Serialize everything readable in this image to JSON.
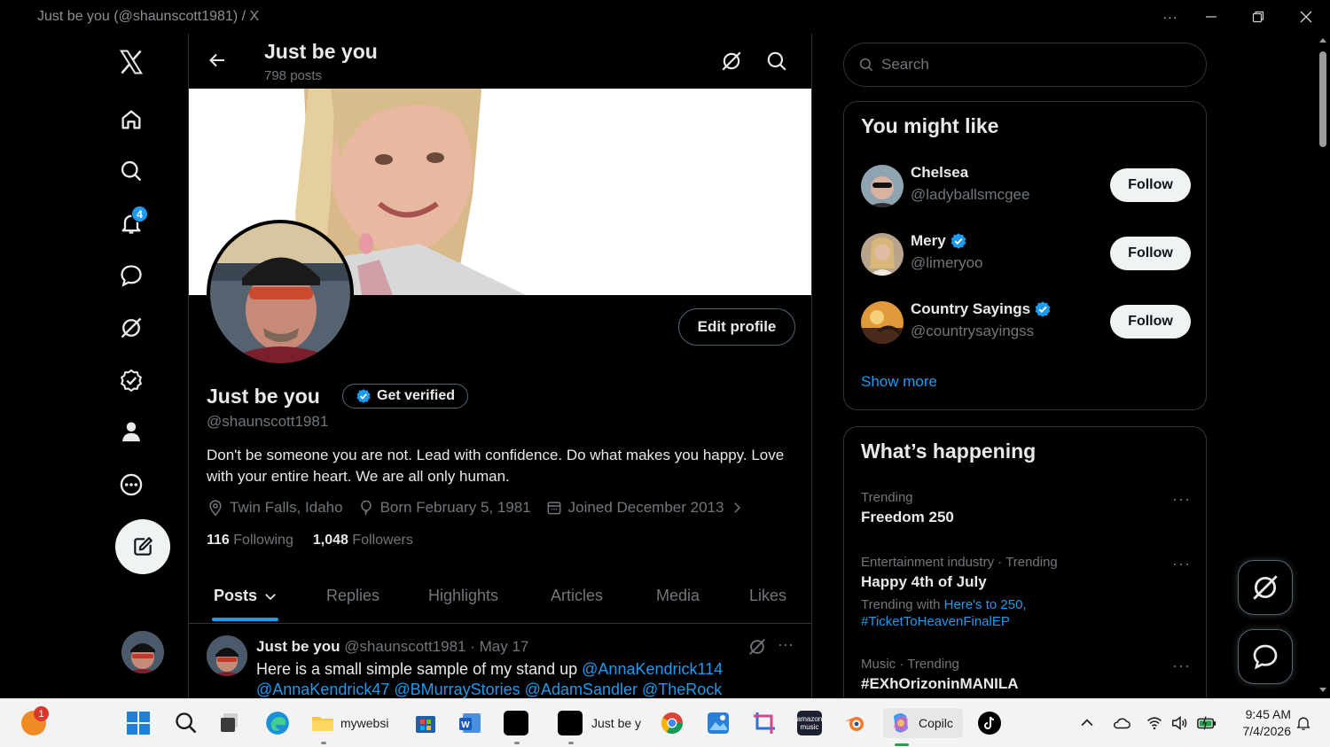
{
  "window": {
    "title": "Just be you (@shaunscott1981) / X",
    "more_label": "···"
  },
  "nav": {
    "notifications_badge": "4"
  },
  "header": {
    "name": "Just be you",
    "post_count": "798 posts"
  },
  "profile": {
    "name": "Just be you",
    "get_verified": "Get verified",
    "handle": "@shaunscott1981",
    "bio": "Don't be someone you are not. Lead with confidence. Do what makes you happy. Love with your entire heart. We are all only human.",
    "location": "Twin Falls, Idaho",
    "born": "Born February 5, 1981",
    "joined": "Joined December 2013",
    "following_count": "116",
    "following_label": "Following",
    "followers_count": "1,048",
    "followers_label": "Followers",
    "edit_profile": "Edit profile"
  },
  "tabs": [
    "Posts",
    "Replies",
    "Highlights",
    "Articles",
    "Media",
    "Likes"
  ],
  "post": {
    "author": "Just be you",
    "meta": "@shaunscott1981 · May 17",
    "text": "Here is a small simple sample of my stand up",
    "mention1": "@AnnaKendrick114",
    "mentions_line2": "@AnnaKendrick47 @BMurrayStories @AdamSandler @TheRock",
    "more": "···"
  },
  "search": {
    "placeholder": "Search"
  },
  "you_might_like": {
    "title": "You might like",
    "users": [
      {
        "name": "Chelsea",
        "handle": "@ladyballsmcgee",
        "verified": false,
        "button": "Follow"
      },
      {
        "name": "Mery",
        "handle": "@limeryoo",
        "verified": true,
        "button": "Follow"
      },
      {
        "name": "Country Sayings",
        "handle": "@countrysayingss",
        "verified": true,
        "button": "Follow"
      }
    ],
    "show_more": "Show more"
  },
  "whats_happening": {
    "title": "What’s happening",
    "trends": [
      {
        "context": "Trending",
        "topic": "Freedom 250"
      },
      {
        "context": "Entertainment industry · Trending",
        "topic": "Happy 4th of July",
        "with_label": "Trending with",
        "with_link1": "Here's to 250,",
        "with_link2": "#TicketToHeavenFinalEP"
      },
      {
        "context": "Music · Trending",
        "topic": "#EXhOrizoninMANILA"
      }
    ],
    "more": "···"
  },
  "taskbar": {
    "notification_badge": "1",
    "apps": {
      "explorer": "mywebsi",
      "x_window": "Just be y",
      "copilot": "Copilc",
      "amazon_music": "amazon music"
    },
    "time": "9:45 AM",
    "date": "7/4/2026"
  },
  "colors": {
    "accent": "#1d9bf0",
    "background": "#000000",
    "text": "#e7e9ea",
    "muted": "#71767b",
    "border": "#2f3336"
  }
}
